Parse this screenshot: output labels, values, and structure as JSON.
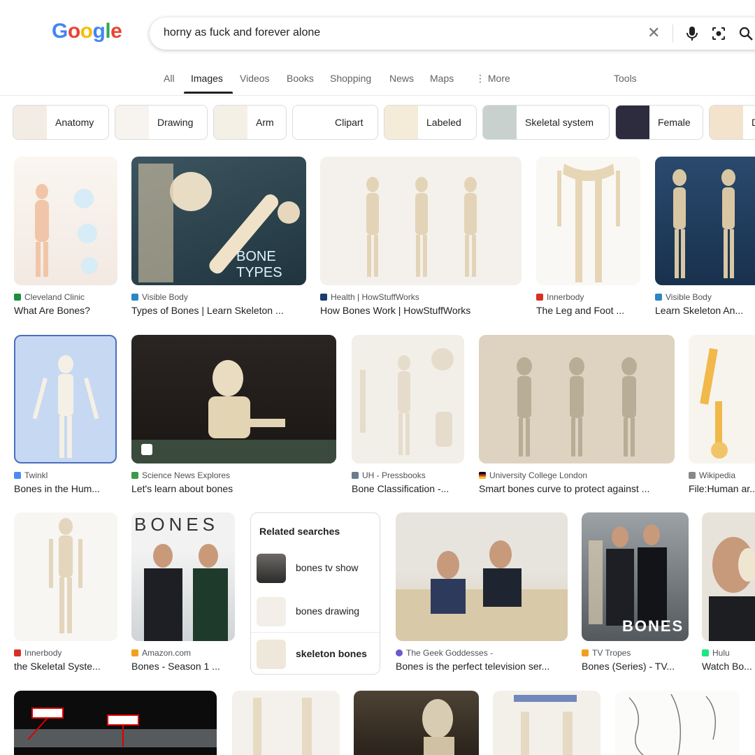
{
  "search": {
    "query": "horny as fuck and forever alone"
  },
  "logo": {
    "letters": [
      {
        "ch": "G",
        "color": "#4285F4"
      },
      {
        "ch": "o",
        "color": "#EA4335"
      },
      {
        "ch": "o",
        "color": "#FBBC05"
      },
      {
        "ch": "g",
        "color": "#4285F4"
      },
      {
        "ch": "l",
        "color": "#34A853"
      },
      {
        "ch": "e",
        "color": "#EA4335"
      }
    ]
  },
  "tabs": [
    "All",
    "Images",
    "Videos",
    "Books",
    "Shopping",
    "News",
    "Maps",
    "More",
    "Tools"
  ],
  "chips": [
    "Anatomy",
    "Drawing",
    "Arm",
    "Clipart",
    "Labeled",
    "Skeletal system",
    "Female",
    "D"
  ],
  "results": [
    {
      "source": "Cleveland Clinic",
      "title": "What Are Bones?"
    },
    {
      "source": "Visible Body",
      "title": "Types of Bones | Learn Skeleton ...",
      "overlay": "BONE TYPES"
    },
    {
      "source": "Health | HowStuffWorks",
      "title": "How Bones Work | HowStuffWorks"
    },
    {
      "source": "Innerbody",
      "title": "The Leg and Foot ..."
    },
    {
      "source": "Visible Body",
      "title": "Learn Skeleton An..."
    },
    {
      "source": "Twinkl",
      "title": "Bones in the Hum..."
    },
    {
      "source": "Science News Explores",
      "title": "Let's learn about bones"
    },
    {
      "source": "UH - Pressbooks",
      "title": "Bone Classification -..."
    },
    {
      "source": "University College London",
      "title": "Smart bones curve to protect against ..."
    },
    {
      "source": "Wikipedia",
      "title": "File:Human ar..."
    },
    {
      "source": "Innerbody",
      "title": "the Skeletal Syste..."
    },
    {
      "source": "Amazon.com",
      "title": "Bones - Season 1 ...",
      "overlay": "BONES"
    },
    {
      "source": "The Geek Goddesses -",
      "title": "Bones is the perfect television ser..."
    },
    {
      "source": "TV Tropes",
      "title": "Bones (Series) - TV...",
      "overlay": "BONES"
    },
    {
      "source": "Hulu",
      "title": "Watch Bo..."
    }
  ],
  "related": {
    "heading": "Related searches",
    "items": [
      "bones tv show",
      "bones drawing",
      "skeleton bones"
    ]
  },
  "colors": {
    "accent": "#1a73e8",
    "text": "#202124",
    "muted": "#5f6368"
  }
}
